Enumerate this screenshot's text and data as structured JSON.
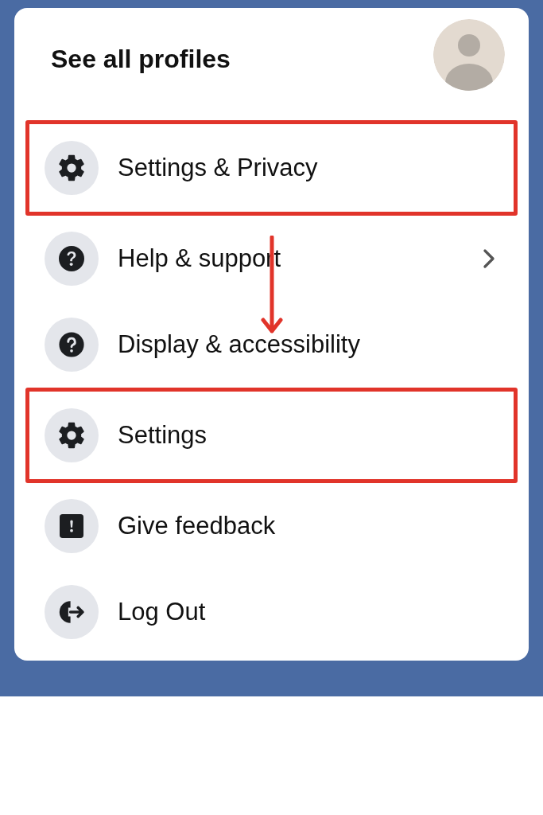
{
  "menu": {
    "title": "See all profiles",
    "items": [
      {
        "kind": "gear",
        "label": "Settings & Privacy",
        "highlighted": true,
        "submenu": false
      },
      {
        "kind": "help",
        "label": "Help & support",
        "highlighted": false,
        "submenu": true
      },
      {
        "kind": "display",
        "label": "Display & accessibility",
        "highlighted": false,
        "submenu": false
      },
      {
        "kind": "gear",
        "label": "Settings",
        "highlighted": true,
        "submenu": false
      },
      {
        "kind": "feedback",
        "label": "Give feedback",
        "highlighted": false,
        "submenu": false
      },
      {
        "kind": "logout",
        "label": "Log Out",
        "highlighted": false,
        "submenu": false
      }
    ]
  }
}
